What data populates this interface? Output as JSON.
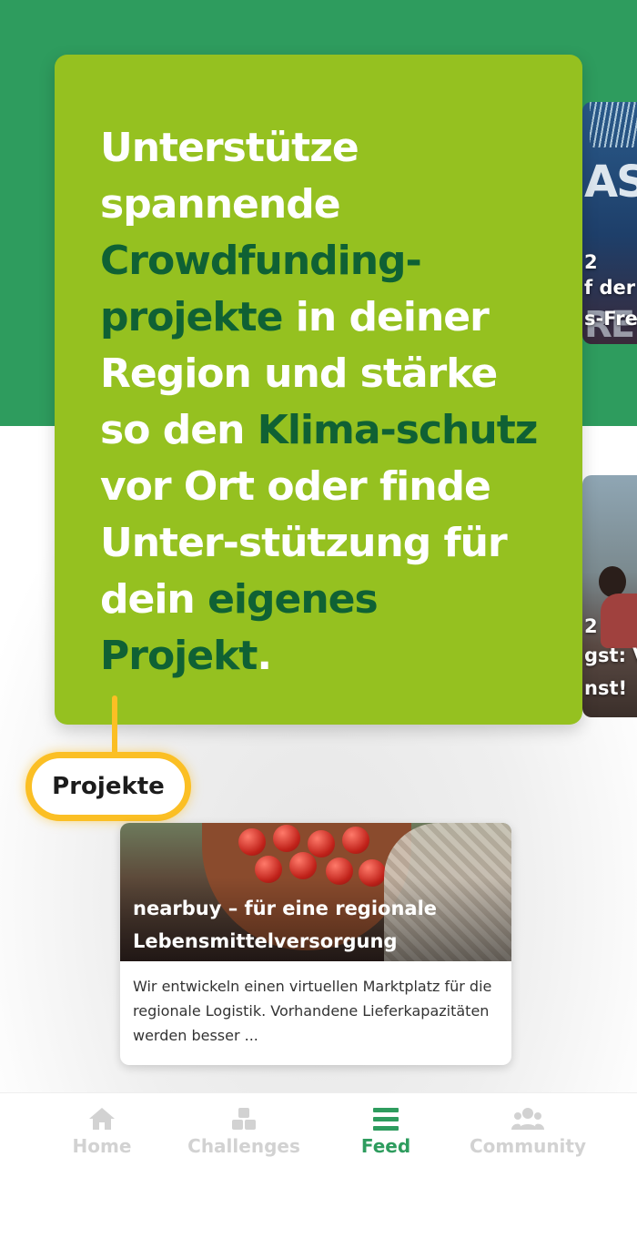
{
  "tooltip": {
    "segments": [
      {
        "text": "Unterstütze spannende ",
        "highlight": false
      },
      {
        "text": "Crowdfunding-projekte",
        "highlight": true
      },
      {
        "text": " in deiner Region und stärke so den ",
        "highlight": false
      },
      {
        "text": "Klima-schutz",
        "highlight": true
      },
      {
        "text": " vor Ort oder finde Unter-stützung für dein ",
        "highlight": false
      },
      {
        "text": "eigenes Projekt",
        "highlight": true
      },
      {
        "text": ".",
        "highlight": false
      }
    ]
  },
  "peek_cards": {
    "card1": {
      "bg_word": "ASS",
      "bg_word2": "RE",
      "year": "2",
      "line1": "f der",
      "line2": "s-Fre"
    },
    "card2": {
      "year": "2",
      "line1": "gst: V",
      "line2": "nst!"
    }
  },
  "pill": {
    "label": "Projekte"
  },
  "project": {
    "title": "nearbuy – für eine regionale Lebensmittelversorgung",
    "description": "Wir entwickeln einen virtuellen Marktplatz für die regionale Logistik. Vorhandene Lieferkapazitäten werden besser ..."
  },
  "nav": {
    "items": [
      {
        "label": "Home",
        "icon": "home-icon",
        "active": false
      },
      {
        "label": "Challenges",
        "icon": "cubes-icon",
        "active": false
      },
      {
        "label": "Feed",
        "icon": "menu-icon",
        "active": true
      },
      {
        "label": "Community",
        "icon": "users-icon",
        "active": false
      }
    ]
  },
  "colors": {
    "brand_green": "#2e9c5e",
    "tooltip_green": "#95c120",
    "highlight_green": "#0f6134",
    "accent_yellow": "#fbbf24"
  }
}
